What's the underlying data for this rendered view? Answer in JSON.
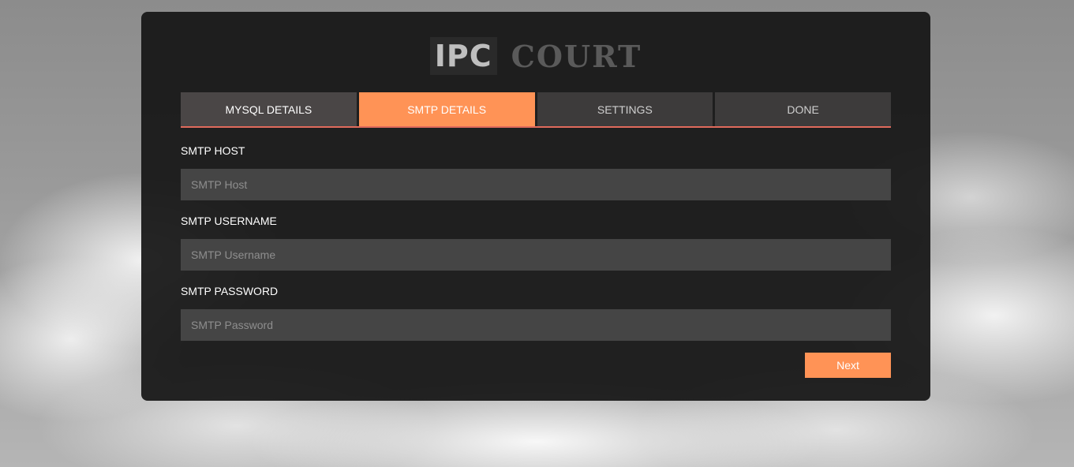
{
  "logo": {
    "part1": "IPC",
    "part2": "COURT"
  },
  "tabs": [
    {
      "label": "MYSQL DETAILS"
    },
    {
      "label": "SMTP DETAILS"
    },
    {
      "label": "SETTINGS"
    },
    {
      "label": "DONE"
    }
  ],
  "active_tab": "SMTP DETAILS",
  "form": {
    "host": {
      "label": "SMTP HOST",
      "placeholder": "SMTP Host",
      "value": ""
    },
    "username": {
      "label": "SMTP USERNAME",
      "placeholder": "SMTP Username",
      "value": ""
    },
    "password": {
      "label": "SMTP PASSWORD",
      "placeholder": "SMTP Password",
      "value": ""
    }
  },
  "actions": {
    "next_label": "Next"
  },
  "colors": {
    "accent": "#ff9356",
    "tab_underline": "#e06a5c",
    "panel_bg": "#161616",
    "input_bg": "#454545"
  }
}
